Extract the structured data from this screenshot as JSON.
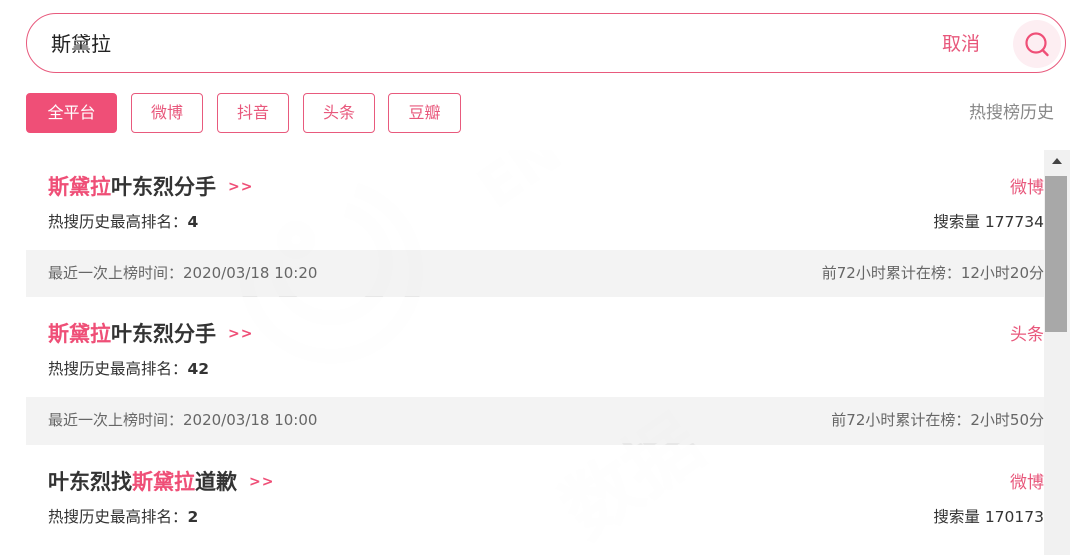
{
  "search": {
    "query": "斯黛拉",
    "cancel_label": "取消"
  },
  "filters": {
    "tabs": [
      "全平台",
      "微博",
      "抖音",
      "头条",
      "豆瓣"
    ],
    "active": "全平台",
    "history_label": "热搜榜历史"
  },
  "results": [
    {
      "title_parts": [
        {
          "text": "斯黛拉",
          "highlight": true
        },
        {
          "text": "叶东烈分手",
          "highlight": false
        }
      ],
      "arrow": ">>",
      "platform": "微博",
      "rank_label": "热搜历史最高排名：",
      "rank": "4",
      "volume_text": "搜索量 177734",
      "last_time_text": "最近一次上榜时间：2020/03/18 10:20",
      "cumulative_text": "前72小时累计在榜：12小时20分"
    },
    {
      "title_parts": [
        {
          "text": "斯黛拉",
          "highlight": true
        },
        {
          "text": "叶东烈分手",
          "highlight": false
        }
      ],
      "arrow": ">>",
      "platform": "头条",
      "rank_label": "热搜历史最高排名：",
      "rank": "42",
      "volume_text": "",
      "last_time_text": "最近一次上榜时间：2020/03/18 10:00",
      "cumulative_text": "前72小时累计在榜：2小时50分"
    },
    {
      "title_parts": [
        {
          "text": "叶东烈找",
          "highlight": false
        },
        {
          "text": "斯黛拉",
          "highlight": true
        },
        {
          "text": "道歉",
          "highlight": false
        }
      ],
      "arrow": ">>",
      "platform": "微博",
      "rank_label": "热搜历史最高排名：",
      "rank": "2",
      "volume_text": "搜索量 170173",
      "last_time_text": "",
      "cumulative_text": ""
    }
  ],
  "colors": {
    "accent": "#ef4f77",
    "accent_text": "#e8587c",
    "muted": "#888888"
  },
  "icons": {
    "search": "search-icon",
    "scroll_up": "scroll-up-arrow-icon"
  }
}
